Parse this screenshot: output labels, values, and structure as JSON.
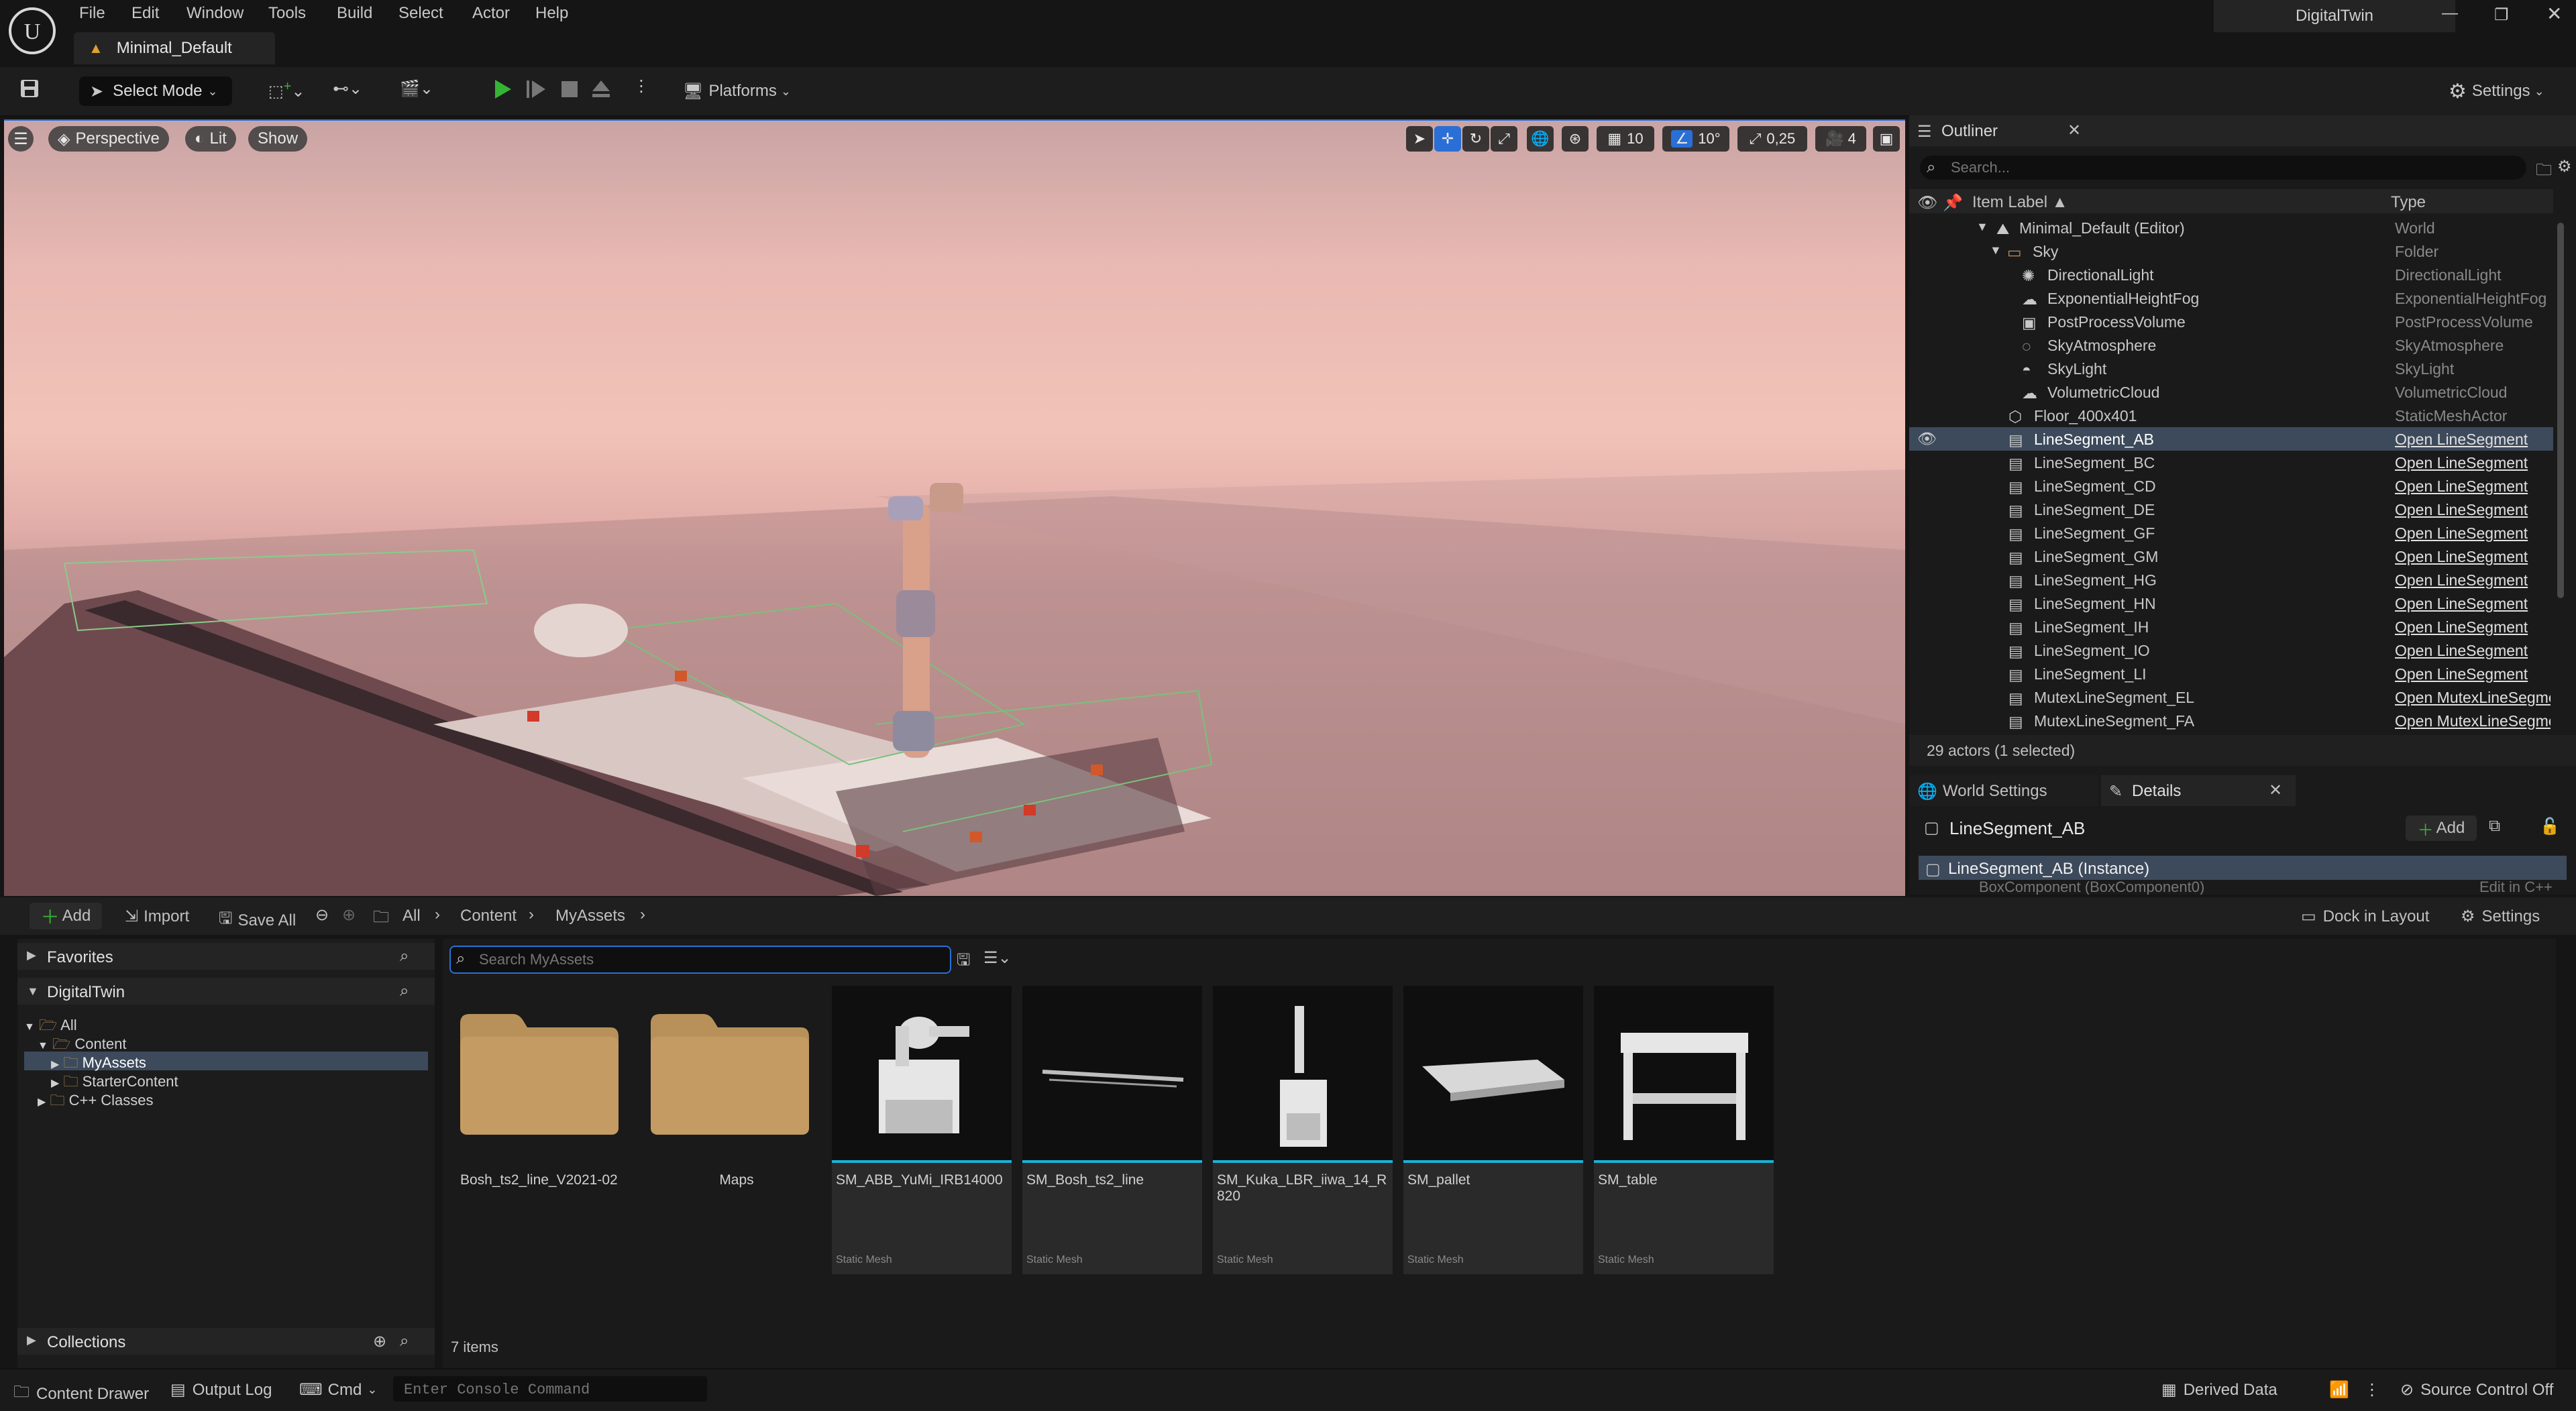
{
  "app": {
    "logo": "unreal-engine-logo",
    "project_name": "DigitalTwin",
    "map_tab": "Minimal_Default",
    "menu": [
      "File",
      "Edit",
      "Window",
      "Tools",
      "Build",
      "Select",
      "Actor",
      "Help"
    ]
  },
  "toolbar": {
    "select_mode": "Select Mode",
    "platforms": "Platforms",
    "settings": "Settings"
  },
  "viewport": {
    "view_mode": "Perspective",
    "lighting": "Lit",
    "show": "Show",
    "grid_snap": "10",
    "rotation_snap": "10°",
    "scale_snap": "0,25",
    "camera_speed": "4"
  },
  "outliner": {
    "title": "Outliner",
    "search_placeholder": "Search...",
    "col_label": "Item Label",
    "col_type": "Type",
    "rows": [
      {
        "label": "Minimal_Default (Editor)",
        "type": "World",
        "icon": "world-icon"
      },
      {
        "label": "Sky",
        "type": "Folder",
        "icon": "folder-icon"
      },
      {
        "label": "DirectionalLight",
        "type": "DirectionalLight",
        "icon": "sun-icon"
      },
      {
        "label": "ExponentialHeightFog",
        "type": "ExponentialHeightFog",
        "icon": "fog-icon"
      },
      {
        "label": "PostProcessVolume",
        "type": "PostProcessVolume",
        "icon": "volume-icon"
      },
      {
        "label": "SkyAtmosphere",
        "type": "SkyAtmosphere",
        "icon": "atmosphere-icon"
      },
      {
        "label": "SkyLight",
        "type": "SkyLight",
        "icon": "skylight-icon"
      },
      {
        "label": "VolumetricCloud",
        "type": "VolumetricCloud",
        "icon": "cloud-icon"
      },
      {
        "label": "Floor_400x401",
        "type": "StaticMeshActor",
        "icon": "mesh-icon"
      },
      {
        "label": "LineSegment_AB",
        "type": "Open LineSegment",
        "icon": "actor-icon"
      },
      {
        "label": "LineSegment_BC",
        "type": "Open LineSegment",
        "icon": "actor-icon"
      },
      {
        "label": "LineSegment_CD",
        "type": "Open LineSegment",
        "icon": "actor-icon"
      },
      {
        "label": "LineSegment_DE",
        "type": "Open LineSegment",
        "icon": "actor-icon"
      },
      {
        "label": "LineSegment_GF",
        "type": "Open LineSegment",
        "icon": "actor-icon"
      },
      {
        "label": "LineSegment_GM",
        "type": "Open LineSegment",
        "icon": "actor-icon"
      },
      {
        "label": "LineSegment_HG",
        "type": "Open LineSegment",
        "icon": "actor-icon"
      },
      {
        "label": "LineSegment_HN",
        "type": "Open LineSegment",
        "icon": "actor-icon"
      },
      {
        "label": "LineSegment_IH",
        "type": "Open LineSegment",
        "icon": "actor-icon"
      },
      {
        "label": "LineSegment_IO",
        "type": "Open LineSegment",
        "icon": "actor-icon"
      },
      {
        "label": "LineSegment_LI",
        "type": "Open LineSegment",
        "icon": "actor-icon"
      },
      {
        "label": "MutexLineSegment_EL",
        "type": "Open MutexLineSegme",
        "icon": "actor-icon"
      },
      {
        "label": "MutexLineSegment_FA",
        "type": "Open MutexLineSegme",
        "icon": "actor-icon"
      }
    ],
    "status": "29 actors (1 selected)"
  },
  "details": {
    "tab_world_settings": "World Settings",
    "tab_details": "Details",
    "selected_actor": "LineSegment_AB",
    "add_label": "Add",
    "instance_row": "LineSegment_AB (Instance)",
    "component_row": "BoxComponent (BoxComponent0)",
    "component_row_right": "Edit in C++"
  },
  "content_browser": {
    "add": "Add",
    "import": "Import",
    "save_all": "Save All",
    "breadcrumb": [
      "All",
      "Content",
      "MyAssets"
    ],
    "dock_in_layout": "Dock in Layout",
    "settings": "Settings",
    "favorites": "Favorites",
    "project": "DigitalTwin",
    "tree": [
      "All",
      "Content",
      "MyAssets",
      "StarterContent",
      "C++ Classes"
    ],
    "collections": "Collections",
    "search_placeholder": "Search MyAssets",
    "folders": [
      "Bosh_ts2_line_V2021-02",
      "Maps"
    ],
    "assets": [
      {
        "name": "SM_ABB_YuMi_IRB14000",
        "kind": "Static Mesh"
      },
      {
        "name": "SM_Bosh_ts2_line",
        "kind": "Static Mesh"
      },
      {
        "name": "SM_Kuka_LBR_iiwa_14_R820",
        "kind": "Static Mesh"
      },
      {
        "name": "SM_pallet",
        "kind": "Static Mesh"
      },
      {
        "name": "SM_table",
        "kind": "Static Mesh"
      }
    ],
    "item_count": "7 items"
  },
  "statusbar": {
    "content_drawer": "Content Drawer",
    "output_log": "Output Log",
    "cmd": "Cmd",
    "console_placeholder": "Enter Console Command",
    "derived_data": "Derived Data",
    "source_control": "Source Control Off"
  },
  "colors": {
    "accent_blue": "#2a6fd6",
    "selection": "#3d4a5c",
    "asset_bar": "#1ab3d9",
    "folder": "#b8915a",
    "play_green": "#35b335"
  }
}
